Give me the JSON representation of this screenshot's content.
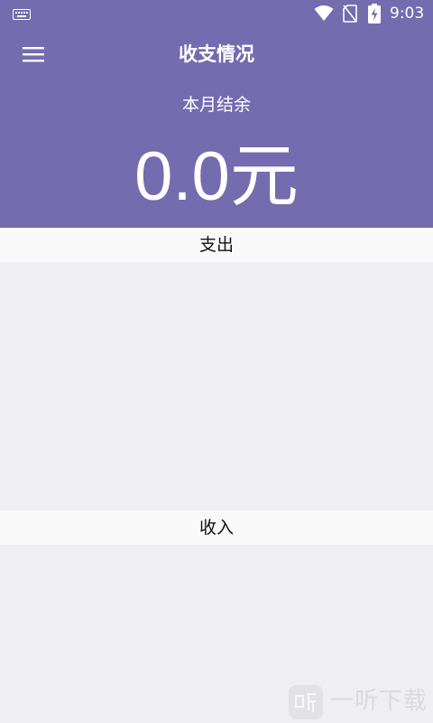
{
  "status_bar": {
    "time": "9:03",
    "icons": [
      "keyboard-icon",
      "wifi-icon",
      "no-sim-icon",
      "battery-charging-icon"
    ]
  },
  "app_bar": {
    "menu_icon": "hamburger-menu-icon",
    "title": "收支情况"
  },
  "summary": {
    "label": "本月结余",
    "amount": "0.0元"
  },
  "sections": {
    "expense": {
      "title": "支出"
    },
    "income": {
      "title": "收入"
    }
  },
  "watermark": {
    "text": "一听下载"
  },
  "colors": {
    "header_bg": "#736caf",
    "page_bg": "#efeff3",
    "section_header_bg": "#f9f9fa"
  }
}
